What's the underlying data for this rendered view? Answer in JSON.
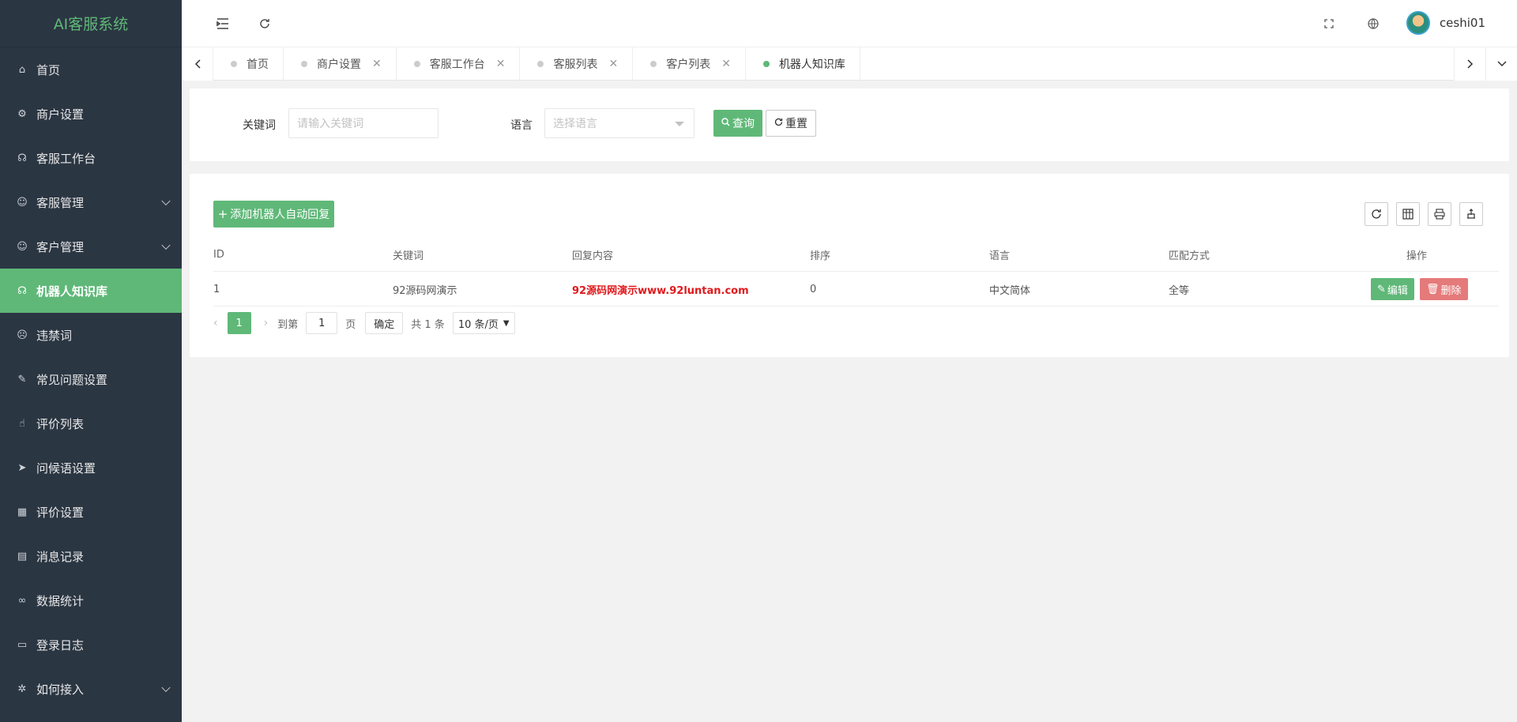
{
  "app": {
    "title": "AI客服系统"
  },
  "sidebar": {
    "items": [
      {
        "label": "首页",
        "icon": "home-icon",
        "glyph": "⌂"
      },
      {
        "label": "商户设置",
        "icon": "gear-icon",
        "glyph": "⚙"
      },
      {
        "label": "客服工作台",
        "icon": "headset-icon",
        "glyph": "☊"
      },
      {
        "label": "客服管理",
        "icon": "user-icon",
        "glyph": "☺"
      },
      {
        "label": "客户管理",
        "icon": "customer-icon",
        "glyph": "☺"
      },
      {
        "label": "机器人知识库",
        "icon": "robot-icon",
        "glyph": "☊"
      },
      {
        "label": "违禁词",
        "icon": "smiley-icon",
        "glyph": "☹"
      },
      {
        "label": "常见问题设置",
        "icon": "edit-note-icon",
        "glyph": "✎"
      },
      {
        "label": "评价列表",
        "icon": "thumbs-up-icon",
        "glyph": "☝"
      },
      {
        "label": "问候语设置",
        "icon": "send-icon",
        "glyph": "➤"
      },
      {
        "label": "评价设置",
        "icon": "calendar-icon",
        "glyph": "▦"
      },
      {
        "label": "消息记录",
        "icon": "clipboard-icon",
        "glyph": "▤"
      },
      {
        "label": "数据统计",
        "icon": "link-icon",
        "glyph": "∞"
      },
      {
        "label": "登录日志",
        "icon": "window-icon",
        "glyph": "▭"
      },
      {
        "label": "如何接入",
        "icon": "settings-icon",
        "glyph": "✲"
      }
    ]
  },
  "header": {
    "username": "ceshi01"
  },
  "tabs": [
    {
      "label": "首页"
    },
    {
      "label": "商户设置",
      "close": "✕"
    },
    {
      "label": "客服工作台",
      "close": "✕"
    },
    {
      "label": "客服列表",
      "close": "✕"
    },
    {
      "label": "客户列表",
      "close": "✕"
    },
    {
      "label": "机器人知识库"
    }
  ],
  "search": {
    "keyword_label": "关键词",
    "keyword_placeholder": "请输入关键词",
    "language_label": "语言",
    "language_placeholder": "选择语言",
    "query_button": "查询",
    "reset_button": "重置"
  },
  "table": {
    "add_button": "添加机器人自动回复",
    "headers": [
      "ID",
      "关键词",
      "回复内容",
      "排序",
      "语言",
      "匹配方式",
      "操作"
    ],
    "rows": [
      [
        "1",
        "92源码网演示",
        "92源码网演示www.92luntan.com",
        "0",
        "中文简体",
        "全等"
      ]
    ],
    "edit_button": "编辑",
    "delete_button": "删除"
  },
  "pagination": {
    "current_page": "1",
    "goto_label": "到第",
    "goto_value": "1",
    "page_unit": "页",
    "confirm_button": "确定",
    "total_text": "共 1 条",
    "page_size": "10 条/页"
  },
  "colors": {
    "accent": "#5fb878",
    "sidebar_bg": "#2b3643",
    "danger": "#e57a7a",
    "reply_text": "#e0191c"
  }
}
